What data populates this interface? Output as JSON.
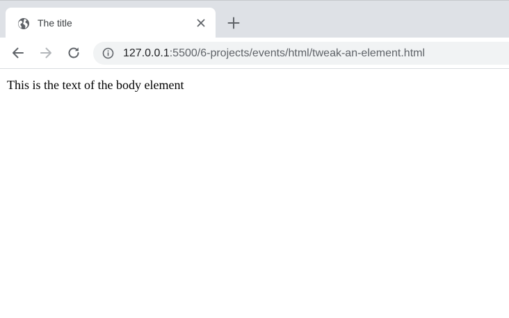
{
  "tab": {
    "title": "The title",
    "favicon": "globe-icon",
    "close_icon": "close-icon"
  },
  "new_tab_icon": "plus-icon",
  "toolbar": {
    "back_icon": "arrow-left-icon",
    "forward_icon": "arrow-right-icon",
    "reload_icon": "reload-icon",
    "info_icon": "info-icon"
  },
  "address_bar": {
    "host": "127.0.0.1",
    "rest": ":5500/6-projects/events/html/tweak-an-element.html"
  },
  "page": {
    "body_text": "This is the text of the body element"
  },
  "colors": {
    "tab_strip": "#dee1e6",
    "omnibox": "#f1f3f4",
    "icon": "#5f6368",
    "icon_disabled": "#b3b6ba"
  }
}
